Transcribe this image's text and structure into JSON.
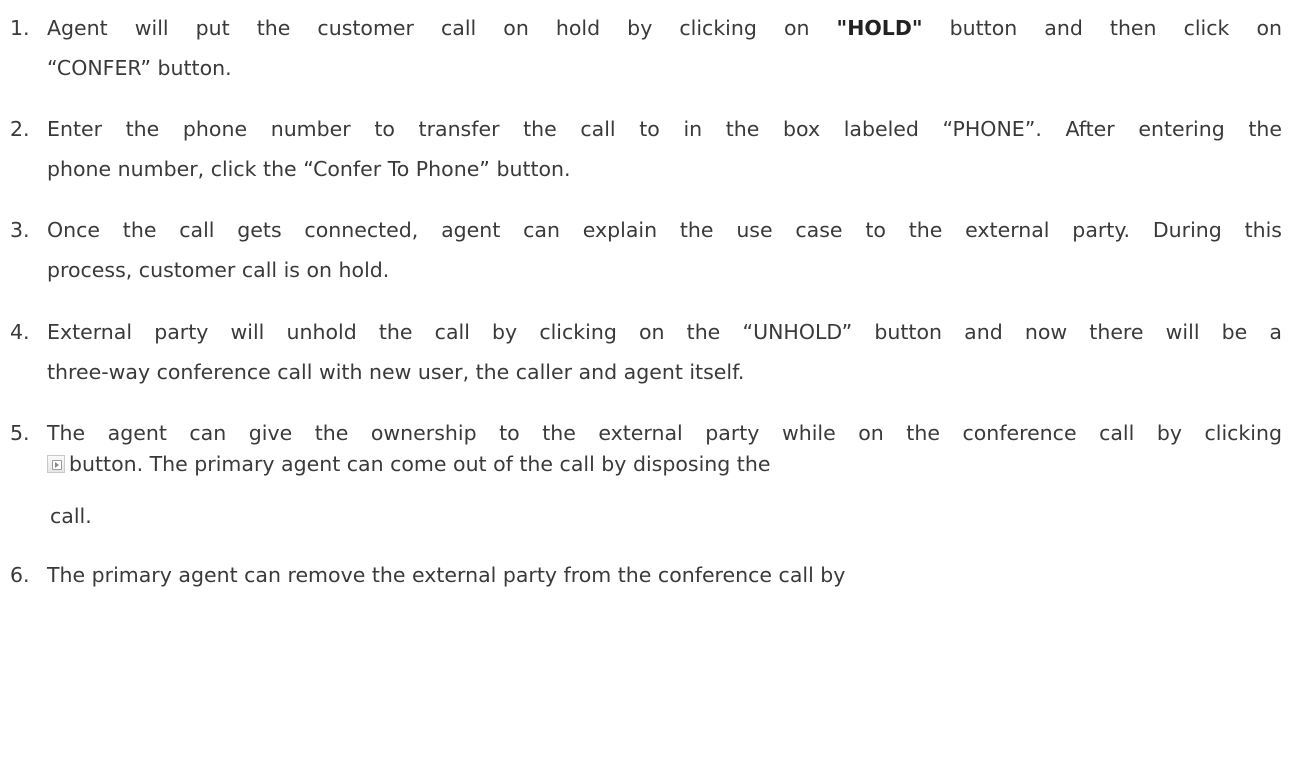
{
  "steps": [
    {
      "number": "1.",
      "line1_a": "Agent will put the customer call on hold by clicking on ",
      "line1_bold": "\"HOLD\"",
      "line1_b": " button and then click on",
      "line2": "“CONFER” button."
    },
    {
      "number": "2.",
      "line1": "Enter the phone number to transfer the call to in the box labeled “PHONE”. After entering the",
      "line2": "phone number, click the “Confer To Phone” button."
    },
    {
      "number": "3.",
      "line1": "Once the call gets connected, agent can explain the use case to the external party. During this",
      "line2": "process, customer call is on hold."
    },
    {
      "number": "4.",
      "line1": "External party will unhold the call by clicking on the “UNHOLD” button and now there will be a",
      "line2": "three-way conference call with new user, the caller and agent itself."
    },
    {
      "number": "5.",
      "line1": "The agent can give the ownership to the external party while on the conference call by clicking",
      "line2_icon": "transfer-ownership-icon",
      "line2": "button. The primary agent can come out of the call by disposing the",
      "line3": "call."
    },
    {
      "number": "6.",
      "line1": "The primary agent can remove the external party from the conference call by"
    }
  ]
}
